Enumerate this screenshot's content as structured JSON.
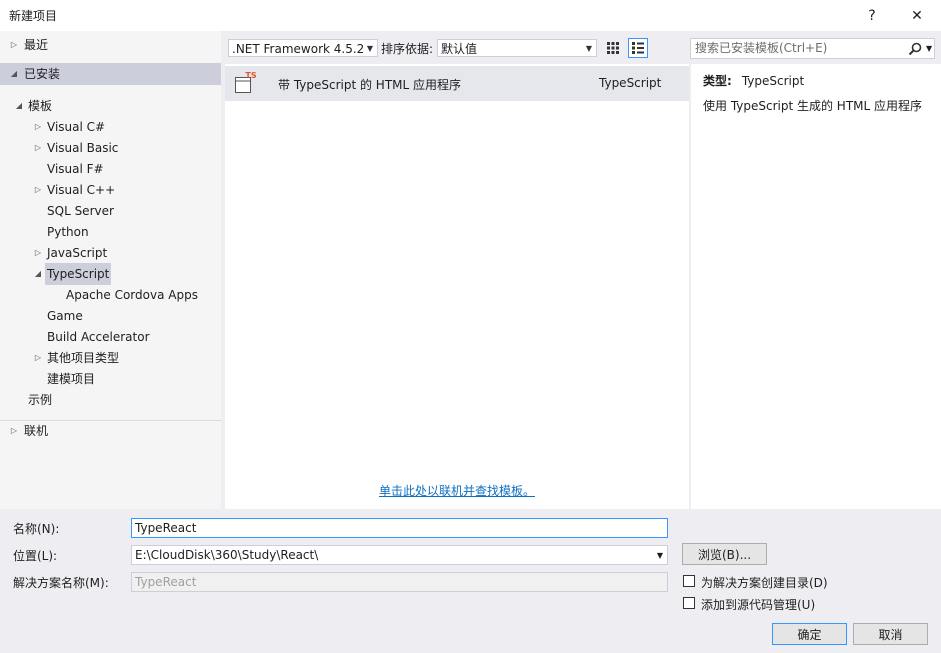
{
  "window": {
    "title": "新建项目",
    "help_label": "?",
    "close_label": "✕"
  },
  "sidebar": {
    "recent": "最近",
    "installed": "已安装",
    "templates": "模板",
    "items": [
      {
        "label": "Visual C#",
        "expandable": true
      },
      {
        "label": "Visual Basic",
        "expandable": true
      },
      {
        "label": "Visual F#",
        "expandable": false
      },
      {
        "label": "Visual C++",
        "expandable": true
      },
      {
        "label": "SQL Server",
        "expandable": false
      },
      {
        "label": "Python",
        "expandable": false
      },
      {
        "label": "JavaScript",
        "expandable": true
      },
      {
        "label": "TypeScript",
        "expandable": true,
        "selected": true
      },
      {
        "label": "Apache Cordova Apps",
        "expandable": false
      },
      {
        "label": "Game",
        "expandable": false
      },
      {
        "label": "Build Accelerator",
        "expandable": false
      },
      {
        "label": "其他项目类型",
        "expandable": true
      },
      {
        "label": "建模项目",
        "expandable": false
      }
    ],
    "samples": "示例",
    "online": "联机"
  },
  "toolbar": {
    "framework": ".NET Framework 4.5.2",
    "sort_label": "排序依据:",
    "sort_value": "默认值",
    "search_placeholder": "搜索已安装模板(Ctrl+E)"
  },
  "templates_list": [
    {
      "icon_badge": "TS",
      "name": "带 TypeScript 的 HTML 应用程序",
      "language": "TypeScript"
    }
  ],
  "online_link": "单击此处以联机并查找模板。",
  "details": {
    "type_label": "类型:",
    "type_value": "TypeScript",
    "description": "使用 TypeScript 生成的 HTML 应用程序"
  },
  "form": {
    "name_label": "名称(N):",
    "name_value": "TypeReact",
    "location_label": "位置(L):",
    "location_value": "E:\\CloudDisk\\360\\Study\\React\\",
    "solution_label": "解决方案名称(M):",
    "solution_value": "TypeReact",
    "browse_label": "浏览(B)...",
    "create_dir_label": "为解决方案创建目录(D)",
    "add_source_label": "添加到源代码管理(U)",
    "ok_label": "确定",
    "cancel_label": "取消"
  },
  "colors": {
    "accent": "#3399ff",
    "selection": "#cccedb",
    "link": "#0e70c0",
    "ts_badge": "#e05a2b"
  }
}
